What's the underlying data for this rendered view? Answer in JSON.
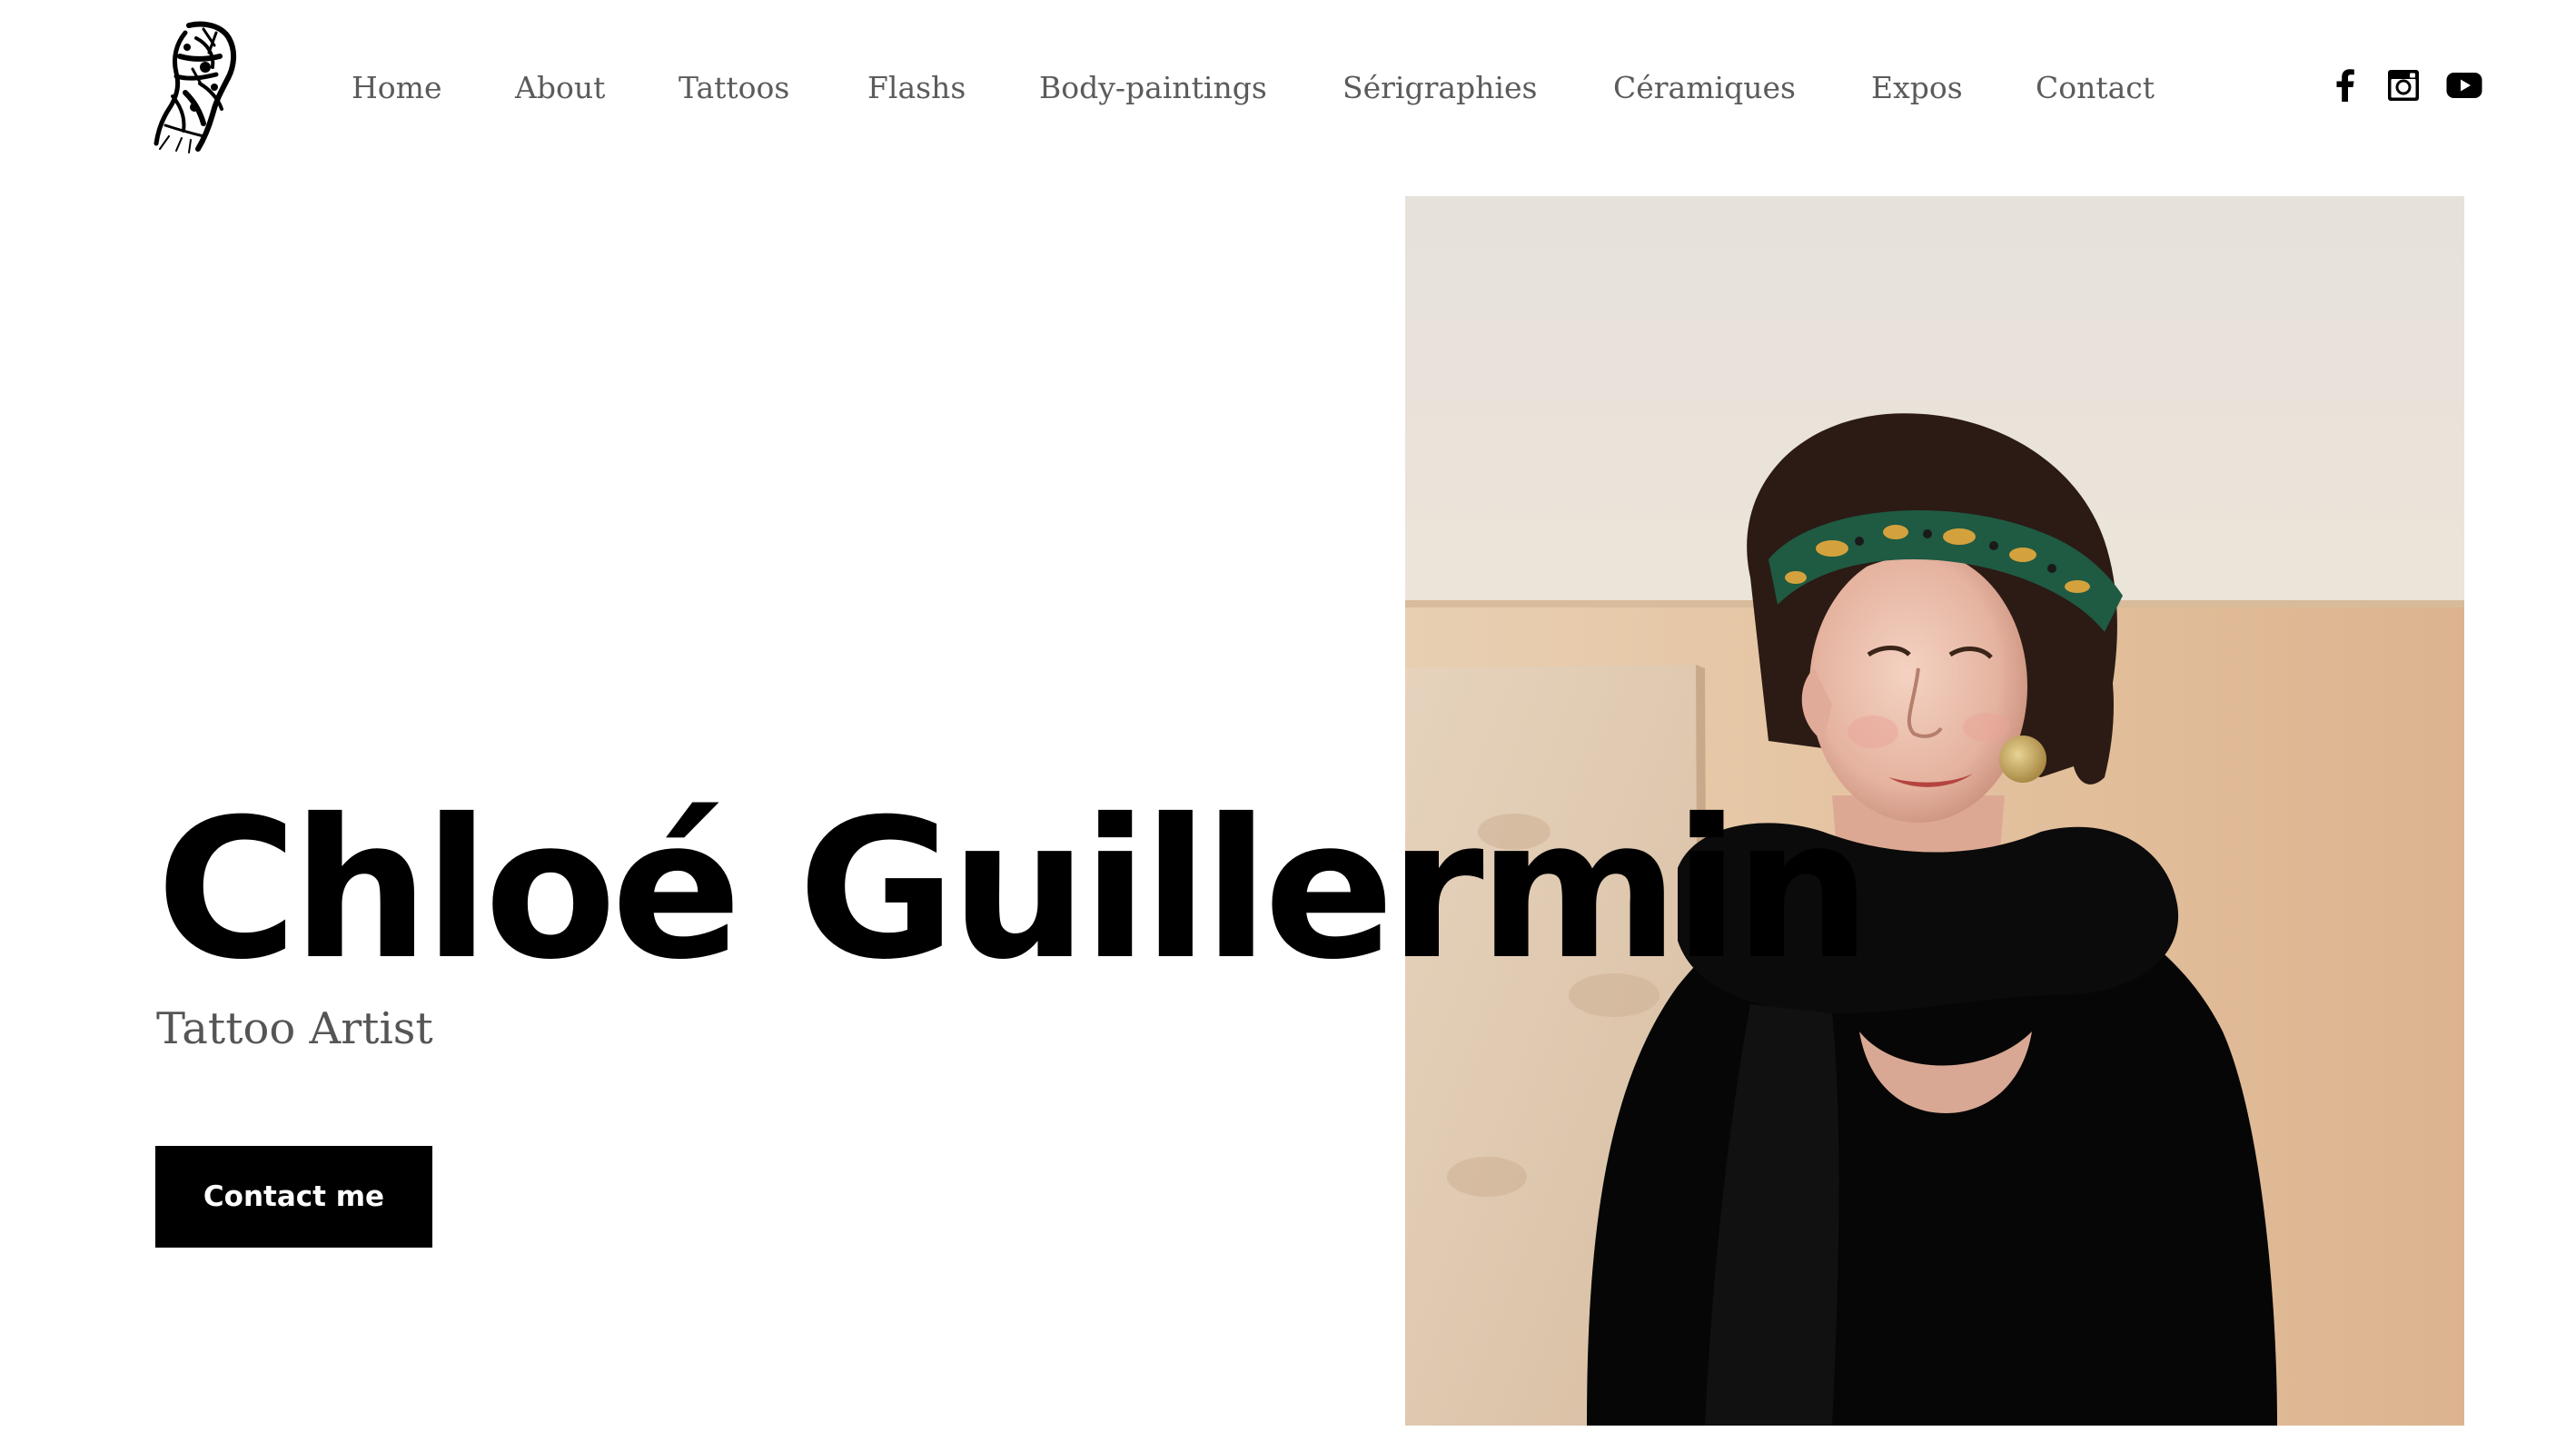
{
  "nav": {
    "items": [
      {
        "label": "Home"
      },
      {
        "label": "About"
      },
      {
        "label": "Tattoos"
      },
      {
        "label": "Flashs"
      },
      {
        "label": "Body-paintings"
      },
      {
        "label": "Sérigraphies"
      },
      {
        "label": "Céramiques"
      },
      {
        "label": "Expos"
      },
      {
        "label": "Contact"
      }
    ]
  },
  "social": {
    "icons": [
      "facebook-icon",
      "instagram-icon",
      "youtube-icon"
    ]
  },
  "hero": {
    "name": "Chloé Guillermin",
    "subtitle": "Tattoo Artist",
    "cta_label": "Contact me"
  },
  "colors": {
    "text": "#000000",
    "nav_text": "#5b5b5b",
    "subtitle": "#555555",
    "button_bg": "#000000",
    "button_text": "#ffffff",
    "background": "#ffffff"
  }
}
